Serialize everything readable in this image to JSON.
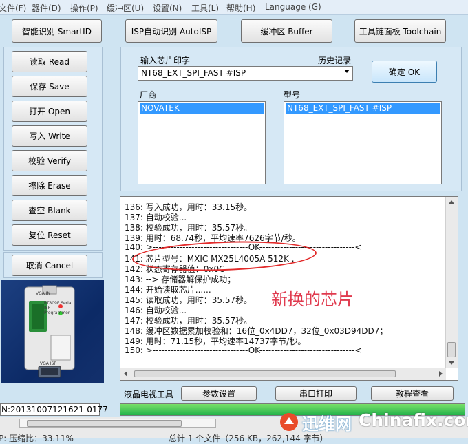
{
  "menu": {
    "items": [
      "文件(F)",
      "器件(D)",
      "操作(P)",
      "缓冲区(U)",
      "设置(N)",
      "工具(L)",
      "帮助(H)",
      "Language (G)"
    ]
  },
  "top_buttons": {
    "smart_id": "智能识别 SmartID",
    "auto_isp": "ISP自动识别 AutoISP",
    "buffer": "缓冲区 Buffer",
    "toolchain": "工具链面板 Toolchain"
  },
  "side_buttons": {
    "read": "读取 Read",
    "save": "保存 Save",
    "open": "打开 Open",
    "write": "写入 Write",
    "verify": "校验 Verify",
    "erase": "擦除 Erase",
    "blank": "查空 Blank",
    "reset": "复位 Reset",
    "cancel": "取消 Cancel"
  },
  "chip_input": {
    "label": "输入芯片印字",
    "history_label": "历史记录",
    "value": "NT68_EXT_SPI_FAST #ISP",
    "ok_label": "确定 OK"
  },
  "vendor": {
    "label": "厂商",
    "selected": "NOVATEK"
  },
  "model": {
    "label": "型号",
    "selected": "NT68_EXT_SPI_FAST #ISP"
  },
  "log_lines": [
    "136: 写入成功，用时：33.15秒。",
    "137: 自动校验...",
    "138: 校验成功，用时：35.57秒。",
    "139: 用时：68.74秒，平均速率7626字节/秒。",
    "140: >--------------------------------OK--------------------------------<",
    "141: 芯片型号：MXIC MX25L4005A 512K .",
    "142: 状态寄存器值：0x0C",
    "143: --> 存储器解保护成功；",
    "144: 开始读取芯片......",
    "145: 读取成功，用时：35.57秒。",
    "146: 自动校验...",
    "147: 校验成功，用时：35.57秒。",
    "148: 缓冲区数据累加校验和：16位_0x4DD7，32位_0x03D94DD7；",
    "149: 用时：71.15秒，平均速率14737字节/秒。",
    "150: >--------------------------------OK--------------------------------<"
  ],
  "annotation_text": "新换的芯片",
  "bottom_tools": {
    "label": "液晶电视工具",
    "params": "参数设置",
    "serial_print": "串口打印",
    "tutorial": "教程查看"
  },
  "serial_field": "N:20131007121621-0177",
  "progress": {
    "fraction": 1.0
  },
  "status": {
    "compress": "P: 压缩比：33.11%",
    "summary": "总计 1 个文件（256 KB，262,144 字节）"
  },
  "device_image": {
    "label": "RT809F Serial ISP Programmer",
    "vga_in": "VGA IN",
    "vga_isp": "VGA ISP"
  },
  "watermark": {
    "cn": "迅维网",
    "en": "Chinafix.com"
  },
  "colors": {
    "background": "#cfe4f2",
    "selection": "#3399ff",
    "progress": "#22b24a",
    "annotation": "#e22a2a"
  }
}
